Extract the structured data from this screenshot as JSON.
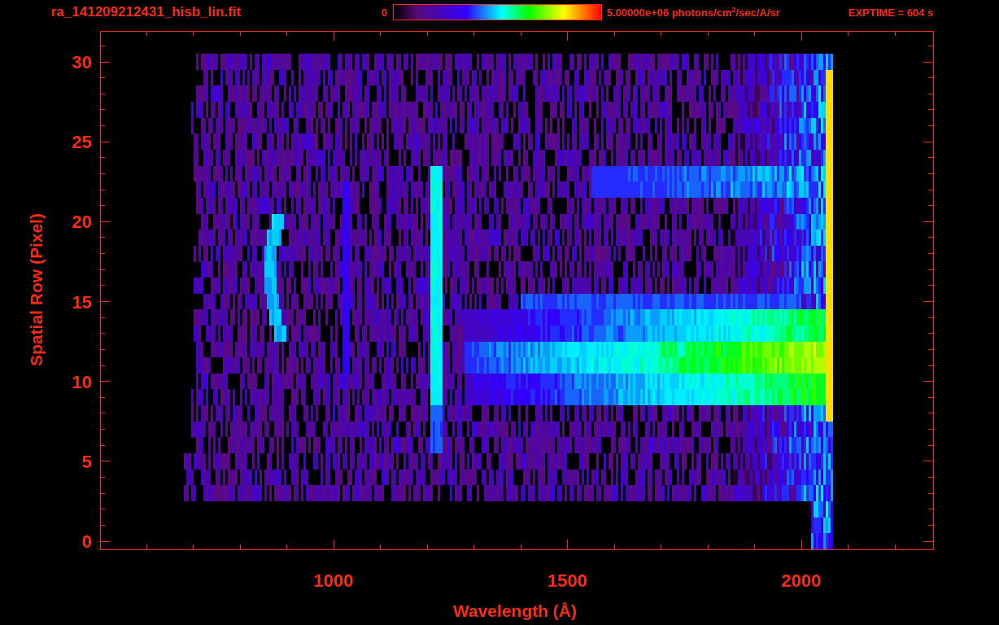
{
  "header": {
    "file_name": "ra_141209212431_hisb_lin.fit",
    "colorbar": {
      "min_label": "0",
      "max_label": "5.00000e+06 photons/cm$^{2}$/sec/A/sr"
    },
    "exposure": "EXPTIME = 604 s"
  },
  "plot": {
    "ylabel": "Spatial Row (Pixel)",
    "xlabel": "Wavelength (Å)",
    "xtick_labels": [
      "1000",
      "1500",
      "2000"
    ],
    "ytick_labels": [
      "30",
      "25",
      "20",
      "15",
      "10",
      "5",
      "0"
    ]
  }
}
